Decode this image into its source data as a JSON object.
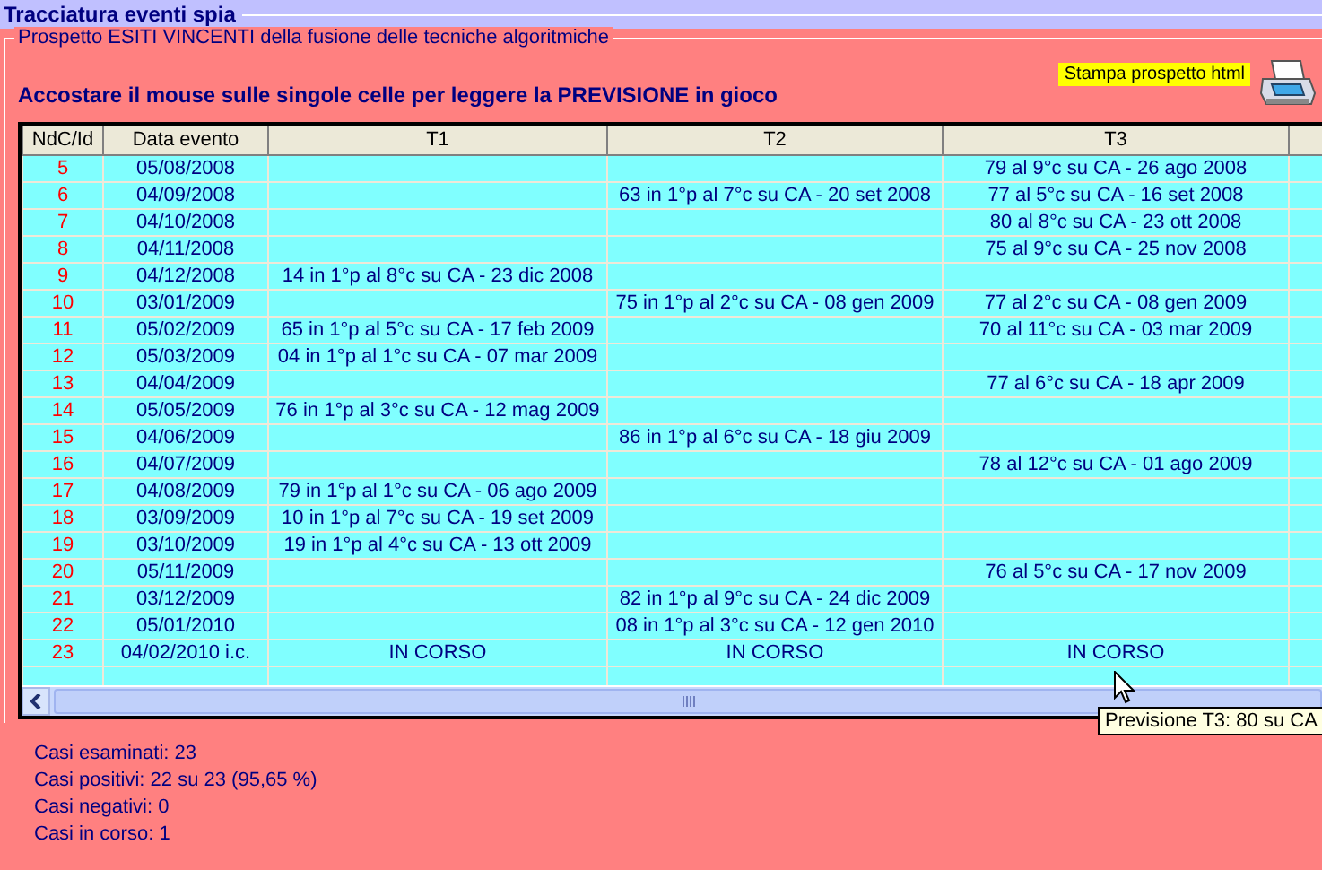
{
  "window": {
    "title": "Tracciatura eventi spia"
  },
  "group": {
    "legend": "Prospetto ESITI VINCENTI della fusione delle tecniche algoritmiche"
  },
  "instruction": "Accostare il mouse sulle singole celle per leggere la PREVISIONE in gioco",
  "print_button": {
    "label": "Stampa prospetto html"
  },
  "table": {
    "columns": [
      "NdC/Id",
      "Data evento",
      "T1",
      "T2",
      "T3"
    ],
    "rows": [
      {
        "id": "5",
        "date": "05/08/2008",
        "t3": "79 al 9°c su CA - 26 ago 2008"
      },
      {
        "id": "6",
        "date": "04/09/2008",
        "t2": "63 in 1°p al 7°c su CA - 20 set 2008",
        "t3": "77 al 5°c su CA - 16 set 2008"
      },
      {
        "id": "7",
        "date": "04/10/2008",
        "t3": "80 al 8°c su CA - 23 ott 2008"
      },
      {
        "id": "8",
        "date": "04/11/2008",
        "t3": "75 al 9°c su CA - 25 nov 2008"
      },
      {
        "id": "9",
        "date": "04/12/2008",
        "t1": "14 in 1°p al 8°c su CA - 23 dic 2008"
      },
      {
        "id": "10",
        "date": "03/01/2009",
        "t2": "75 in 1°p al 2°c su CA - 08 gen 2009",
        "t3": "77 al 2°c su CA - 08 gen 2009"
      },
      {
        "id": "11",
        "date": "05/02/2009",
        "t1": "65 in 1°p al 5°c su CA - 17 feb 2009",
        "t3": "70 al 11°c su CA - 03 mar 2009"
      },
      {
        "id": "12",
        "date": "05/03/2009",
        "t1": "04 in 1°p al 1°c su CA - 07 mar 2009"
      },
      {
        "id": "13",
        "date": "04/04/2009",
        "t3": "77 al 6°c su CA - 18 apr 2009"
      },
      {
        "id": "14",
        "date": "05/05/2009",
        "t1": "76 in 1°p al 3°c su CA - 12 mag 2009"
      },
      {
        "id": "15",
        "date": "04/06/2009",
        "t2": "86 in 1°p al 6°c su CA - 18 giu 2009"
      },
      {
        "id": "16",
        "date": "04/07/2009",
        "t3": "78 al 12°c su CA - 01 ago 2009"
      },
      {
        "id": "17",
        "date": "04/08/2009",
        "t1": "79 in 1°p al 1°c su CA - 06 ago 2009"
      },
      {
        "id": "18",
        "date": "03/09/2009",
        "t1": "10 in 1°p al 7°c su CA - 19 set 2009"
      },
      {
        "id": "19",
        "date": "03/10/2009",
        "t1": "19 in 1°p al 4°c su CA - 13 ott 2009"
      },
      {
        "id": "20",
        "date": "05/11/2009",
        "t3": "76 al 5°c su CA - 17 nov 2009"
      },
      {
        "id": "21",
        "date": "03/12/2009",
        "t2": "82 in 1°p al 9°c su CA - 24 dic 2009"
      },
      {
        "id": "22",
        "date": "05/01/2010",
        "t2": "08 in 1°p al 3°c su CA - 12 gen 2010"
      },
      {
        "id": "23",
        "date": "04/02/2010 i.c.",
        "t1": "IN CORSO",
        "t2": "IN CORSO",
        "t3": "IN CORSO"
      }
    ]
  },
  "tooltip": "Previsione T3: 80 su CA",
  "stats": [
    "Casi esaminati: 23",
    "Casi positivi: 22 su 23 (95,65 %)",
    "Casi negativi: 0",
    "Casi in corso: 1"
  ]
}
